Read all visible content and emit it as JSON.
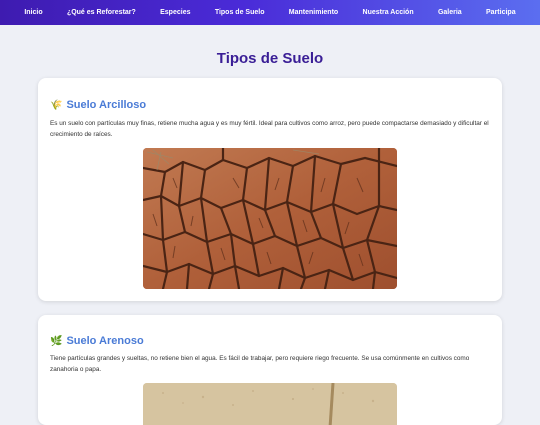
{
  "nav": {
    "items": [
      {
        "label": "Inicio"
      },
      {
        "label": "¿Qué es Reforestar?"
      },
      {
        "label": "Especies"
      },
      {
        "label": "Tipos de Suelo"
      },
      {
        "label": "Mantenimiento"
      },
      {
        "label": "Nuestra Acción"
      },
      {
        "label": "Galeria"
      },
      {
        "label": "Participa"
      }
    ]
  },
  "page": {
    "title": "Tipos de Suelo"
  },
  "soils": [
    {
      "icon": "🌾",
      "icon_name": "wheat-icon",
      "title": "Suelo Arcilloso",
      "description": "Es un suelo con partículas muy finas, retiene mucha agua y es muy fértil. Ideal para cultivos como arroz, pero puede compactarse demasiado y dificultar el crecimiento de raíces."
    },
    {
      "icon": "🌿",
      "icon_name": "herb-icon",
      "title": "Suelo Arenoso",
      "description": "Tiene partículas grandes y sueltas, no retiene bien el agua. Es fácil de trabajar, pero requiere riego frecuente. Se usa comúnmente en cultivos como zanahoria o papa."
    }
  ],
  "colors": {
    "nav_start": "#3e1bb0",
    "nav_end": "#5b6ef0",
    "title": "#3a1e96",
    "card_heading": "#4a7bd6",
    "background": "#eef0f6"
  }
}
